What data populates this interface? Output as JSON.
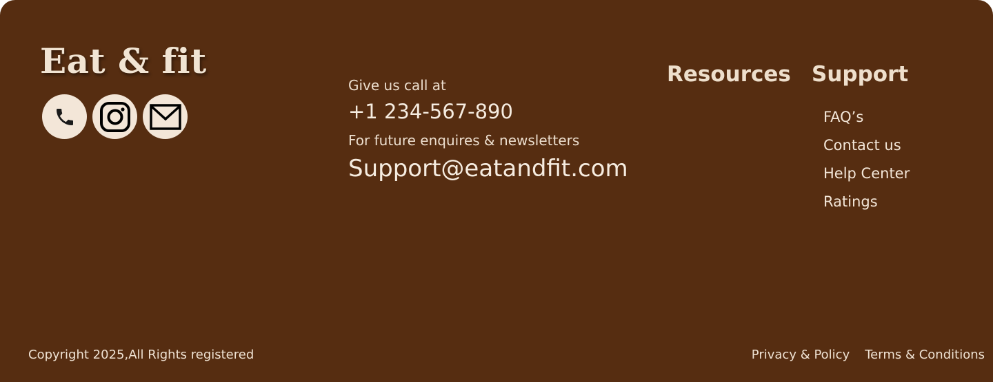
{
  "brand": {
    "name": "Eat & fit"
  },
  "social": [
    {
      "icon": "phone-icon"
    },
    {
      "icon": "instagram-icon"
    },
    {
      "icon": "mail-icon"
    }
  ],
  "contact": {
    "call_label": "Give us call at",
    "phone": "+1 234-567-890",
    "newsletter_label": "For future enquires & newsletters",
    "email": "Support@eatandfit.com"
  },
  "resources": {
    "title": "Resources"
  },
  "support": {
    "title": "Support",
    "links": [
      "FAQ’s",
      "Contact us",
      "Help Center",
      "Ratings"
    ]
  },
  "bottom": {
    "copyright": "Copyright 2025,All Rights registered",
    "privacy": "Privacy & Policy",
    "terms": "Terms & Conditions"
  },
  "colors": {
    "footer_background": "#562d11",
    "text": "#f3e6d8",
    "icon_circle": "#f3e6d8"
  }
}
